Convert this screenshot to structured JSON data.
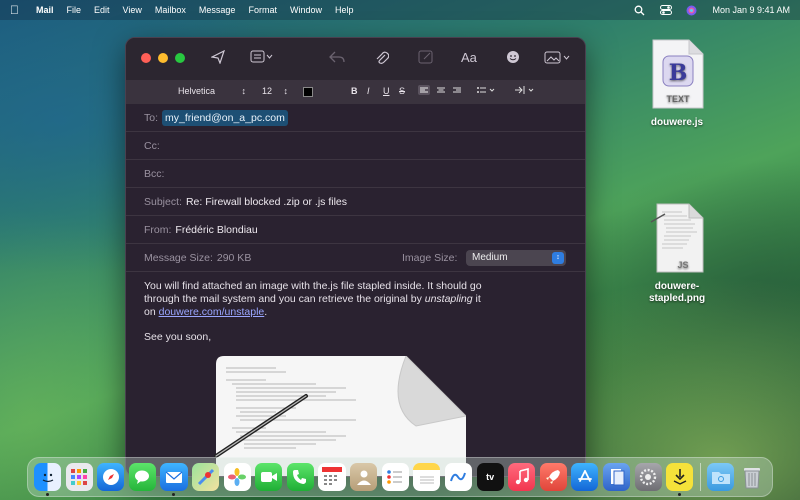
{
  "menubar": {
    "app_name": "Mail",
    "menus": [
      "File",
      "Edit",
      "View",
      "Mailbox",
      "Message",
      "Format",
      "Window",
      "Help"
    ],
    "clock": "Mon Jan 9  9:41 AM"
  },
  "format_bar": {
    "font": "Helvetica",
    "size": "12",
    "bold": "B",
    "italic": "I",
    "underline": "U",
    "strike": "S"
  },
  "message": {
    "to_label": "To:",
    "to_value": "my_friend@on_a_pc.com",
    "cc_label": "Cc:",
    "bcc_label": "Bcc:",
    "subject_label": "Subject:",
    "subject_value": "Re: Firewall blocked .zip or .js files",
    "from_label": "From:",
    "from_value": "Frédéric Blondiau",
    "message_size_label": "Message Size:",
    "message_size_value": "290 KB",
    "image_size_label": "Image Size:",
    "image_size_value": "Medium",
    "body_line1": "You will find attached an image with the.js file stapled inside. It should go",
    "body_line2_pre": "through the mail system and you can retrieve the original by ",
    "body_line2_em": "unstapling",
    "body_line2_post": " it",
    "body_line3_pre": "on ",
    "body_link": "douwere.com/unstaple",
    "body_line3_post": ".",
    "signoff": "See you soon,"
  },
  "desktop": {
    "icon1_label": "douwere.js",
    "icon1_badge": "TEXT",
    "icon1_letter": "B",
    "icon2_label_line1": "douwere-",
    "icon2_label_line2": "stapled.png",
    "icon2_badge": "JS"
  },
  "dock": {
    "apps": [
      "finder-icon",
      "launchpad-icon",
      "safari-icon",
      "messages-icon",
      "mail-icon",
      "maps-icon",
      "photos-icon",
      "facetime-icon",
      "phone-icon",
      "calendar-icon",
      "contacts-icon",
      "reminders-icon",
      "notes-icon",
      "freeform-icon",
      "tv-icon",
      "music-icon",
      "rocket-icon",
      "appstore-icon",
      "preview-icon",
      "settings-icon",
      "stapler-icon",
      "folder-icon",
      "trash-icon"
    ],
    "tv_label": "tv"
  }
}
